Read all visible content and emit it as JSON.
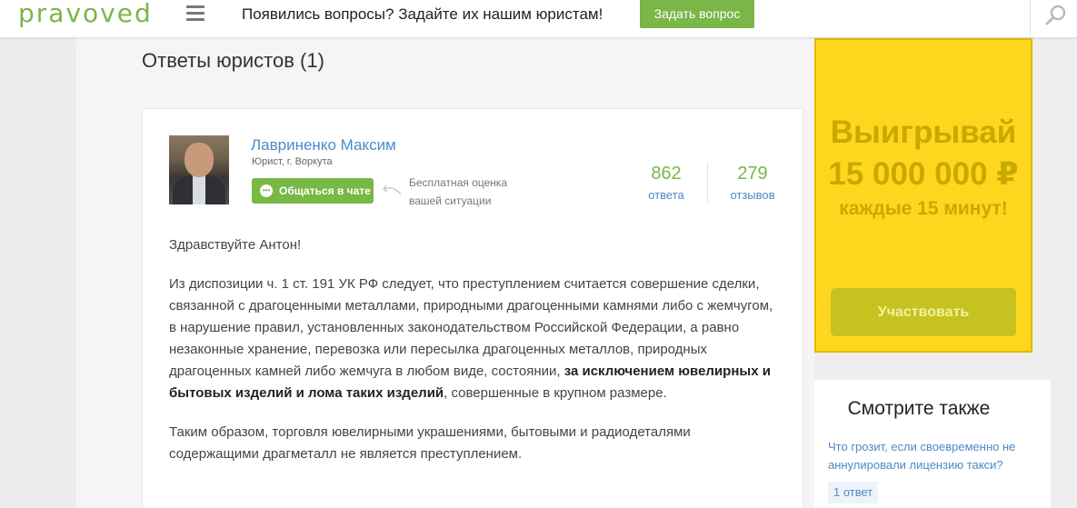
{
  "header": {
    "logo": "pravoved",
    "question": "Появились вопросы? Задайте их нашим юристам!",
    "ask_button": "Задать вопрос"
  },
  "main": {
    "title": "Ответы юристов (1)",
    "answer": {
      "lawyer_name": "Лавриненко Максим",
      "lawyer_role": "Юрист, г. Воркута",
      "chat_button": "Общаться в чате",
      "free_eval_line1": "Бесплатная оценка",
      "free_eval_line2": "вашей ситуации",
      "stats": [
        {
          "value": "862",
          "label": "ответа"
        },
        {
          "value": "279",
          "label": "отзывов"
        }
      ],
      "greeting": "Здравствуйте Антон!",
      "para2_part1": "Из диспозиции ч. 1 ст. 191 УК РФ следует, что преступлением считается совершение сделки, связанной с драгоценными металлами, природными драгоценными камнями либо с жемчугом, в нарушение правил, установленных законодательством Российской Федерации, а равно незаконные хранение, перевозка или пересылка драгоценных металлов, природных драгоценных камней либо жемчуга в любом виде, состоянии, ",
      "para2_bold": "за исключением ювелирных и бытовых изделий и лома таких изделий",
      "para2_part2": ", совершенные в крупном размере.",
      "para3": "Таким образом, торговля ювелирными украшениями, бытовыми и радиодеталями содержащими драгметалл не является преступлением."
    }
  },
  "ad": {
    "title": "Выигрывай",
    "sum": "15 000 000 ₽",
    "sub": "каждые 15 минут!",
    "button": "Участвовать",
    "bg_color": "#ffd61e"
  },
  "see_also": {
    "title": "Смотрите также",
    "link": "Что грозит, если своевременно не аннулировали лицензию такси?",
    "badge": "1 ответ"
  },
  "colors": {
    "brand_green": "#7ab648",
    "link_blue": "#4c8ac7"
  }
}
